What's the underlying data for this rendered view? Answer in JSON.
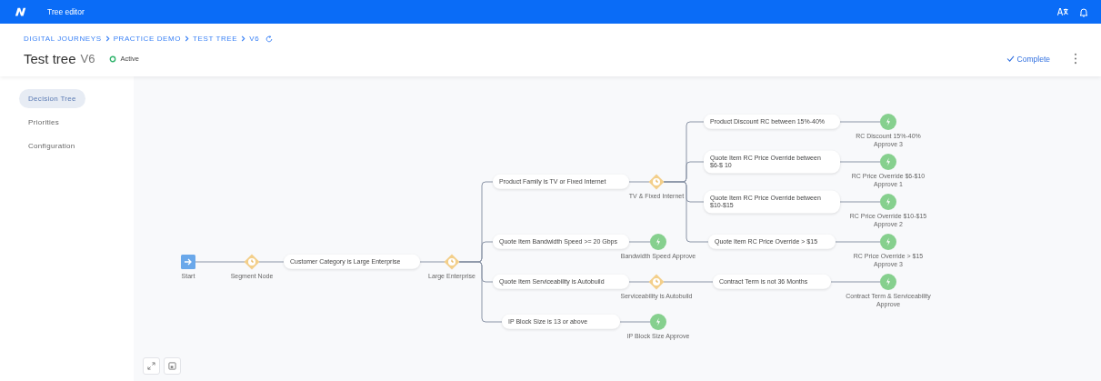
{
  "app_bar": {
    "title": "Tree editor"
  },
  "breadcrumb": [
    "DIGITAL JOURNEYS",
    "PRACTICE DEMO",
    "TEST TREE",
    "V6"
  ],
  "header": {
    "title": "Test tree",
    "version": "V6",
    "status": "Active",
    "complete_button": "Complete"
  },
  "sidebar": {
    "items": [
      {
        "label": "Decision Tree",
        "selected": true
      },
      {
        "label": "Priorities",
        "selected": false
      },
      {
        "label": "Configuration",
        "selected": false
      }
    ]
  },
  "tree": {
    "kind": "start",
    "label": "Start",
    "children": [
      {
        "kind": "segment",
        "label": "Segment Node",
        "children": [
          {
            "kind": "condition",
            "label": "Customer Category is Large Enterprise",
            "children": [
              {
                "kind": "segment",
                "label": "Large Enterprise",
                "children": [
                  {
                    "kind": "condition",
                    "label": "Product Family is TV or Fixed Internet",
                    "children": [
                      {
                        "kind": "segment",
                        "label": "TV & Fixed Internet",
                        "children": [
                          {
                            "kind": "condition",
                            "label": "Product Discount RC between 15%-40%",
                            "children": [
                              {
                                "kind": "approve",
                                "label": "RC Discount 15%-40% Approve 3"
                              }
                            ]
                          },
                          {
                            "kind": "condition",
                            "label": "Quote Item RC Price Override between $6-$ 10",
                            "children": [
                              {
                                "kind": "approve",
                                "label": "RC Price Override $6-$10 Approve 1"
                              }
                            ]
                          },
                          {
                            "kind": "condition",
                            "label": "Quote Item RC Price Override between $10-$15",
                            "children": [
                              {
                                "kind": "approve",
                                "label": "RC Price Override $10-$15 Approve 2"
                              }
                            ]
                          },
                          {
                            "kind": "condition",
                            "label": "Quote Item RC Price Override > $15",
                            "children": [
                              {
                                "kind": "approve",
                                "label": "RC Price Override > $15 Approve 3"
                              }
                            ]
                          }
                        ]
                      }
                    ]
                  },
                  {
                    "kind": "condition",
                    "label": "Quote Item Bandwidth Speed >= 20 Gbps",
                    "children": [
                      {
                        "kind": "approve",
                        "label": "Bandwidth Speed Approve"
                      }
                    ]
                  },
                  {
                    "kind": "condition",
                    "label": "Quote Item Serviceability is Autobuild",
                    "children": [
                      {
                        "kind": "segment",
                        "label": "Serviceability is Autobuild",
                        "children": [
                          {
                            "kind": "condition",
                            "label": "Contract Term is not 36 Months",
                            "children": [
                              {
                                "kind": "approve",
                                "label": "Contract Term & Serviceability Approve"
                              }
                            ]
                          }
                        ]
                      }
                    ]
                  },
                  {
                    "kind": "condition",
                    "label": "IP Block Size is 13 or above",
                    "children": [
                      {
                        "kind": "approve",
                        "label": "IP Block Size Approve"
                      }
                    ]
                  }
                ]
              }
            ]
          }
        ]
      }
    ]
  }
}
